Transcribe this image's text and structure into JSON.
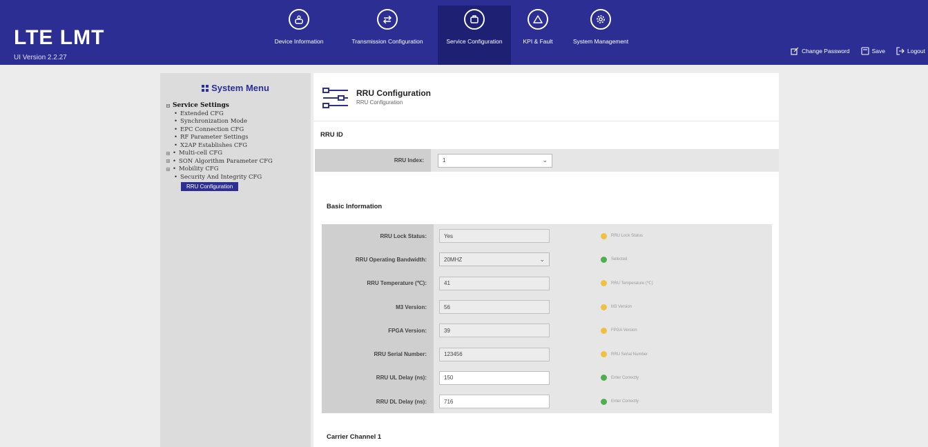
{
  "app": {
    "title": "LTE LMT",
    "version": "UI Version 2.2.27"
  },
  "nav": [
    {
      "label": "Device Information",
      "icon": "device-icon"
    },
    {
      "label": "Transmission Configuration",
      "icon": "transfer-icon"
    },
    {
      "label": "Service Configuration",
      "icon": "service-icon",
      "active": true
    },
    {
      "label": "KPI & Fault",
      "icon": "warning-icon"
    },
    {
      "label": "System Management",
      "icon": "gear-icon"
    }
  ],
  "header_actions": {
    "change_password": "Change Password",
    "save": "Save",
    "logout": "Logout"
  },
  "sidebar": {
    "title": "System Menu",
    "root": "Service Settings",
    "items": [
      {
        "label": "Extended CFG"
      },
      {
        "label": "Synchronization Mode"
      },
      {
        "label": "EPC Connection CFG"
      },
      {
        "label": "RF Parameter Settings"
      },
      {
        "label": "X2AP Establishes CFG"
      },
      {
        "label": "Multi-cell CFG"
      },
      {
        "label": "SON Algorithm Parameter CFG"
      },
      {
        "label": "Mobility CFG"
      },
      {
        "label": "Security And Integrity CFG"
      },
      {
        "label": "RRU Configuration"
      }
    ]
  },
  "page": {
    "title": "RRU Configuration",
    "subtitle": "RRU Configuration",
    "section_id": "RRU ID",
    "rru_index_label": "RRU Index:",
    "rru_index_value": "1",
    "section_basic": "Basic Information",
    "section_carrier": "Carrier Channel 1"
  },
  "rows": [
    {
      "label": "RRU Lock Status:",
      "value": "Yes",
      "hint": "RRU Lock Status"
    },
    {
      "label": "RRU Operating Bandwidth:",
      "value": "20MHZ",
      "hint": "Selected"
    },
    {
      "label": "RRU Temperature (℃):",
      "value": "41",
      "hint": "RRU Temperature (℃)"
    },
    {
      "label": "M3 Version:",
      "value": "56",
      "hint": "M3 Version"
    },
    {
      "label": "FPGA Version:",
      "value": "39",
      "hint": "FPGA Version"
    },
    {
      "label": "RRU Serial Number:",
      "value": "123456",
      "hint": "RRU Serial Number"
    },
    {
      "label": "RRU UL Delay (ns):",
      "value": "150",
      "hint": "Enter Correctly"
    },
    {
      "label": "RRU DL Delay (ns):",
      "value": "716",
      "hint": "Enter Correctly"
    }
  ],
  "colors": {
    "header_bg": "#2c2e94",
    "active_nav": "#1e2074",
    "ok_dot": "#4caf50",
    "info_dot": "#f0c040"
  }
}
